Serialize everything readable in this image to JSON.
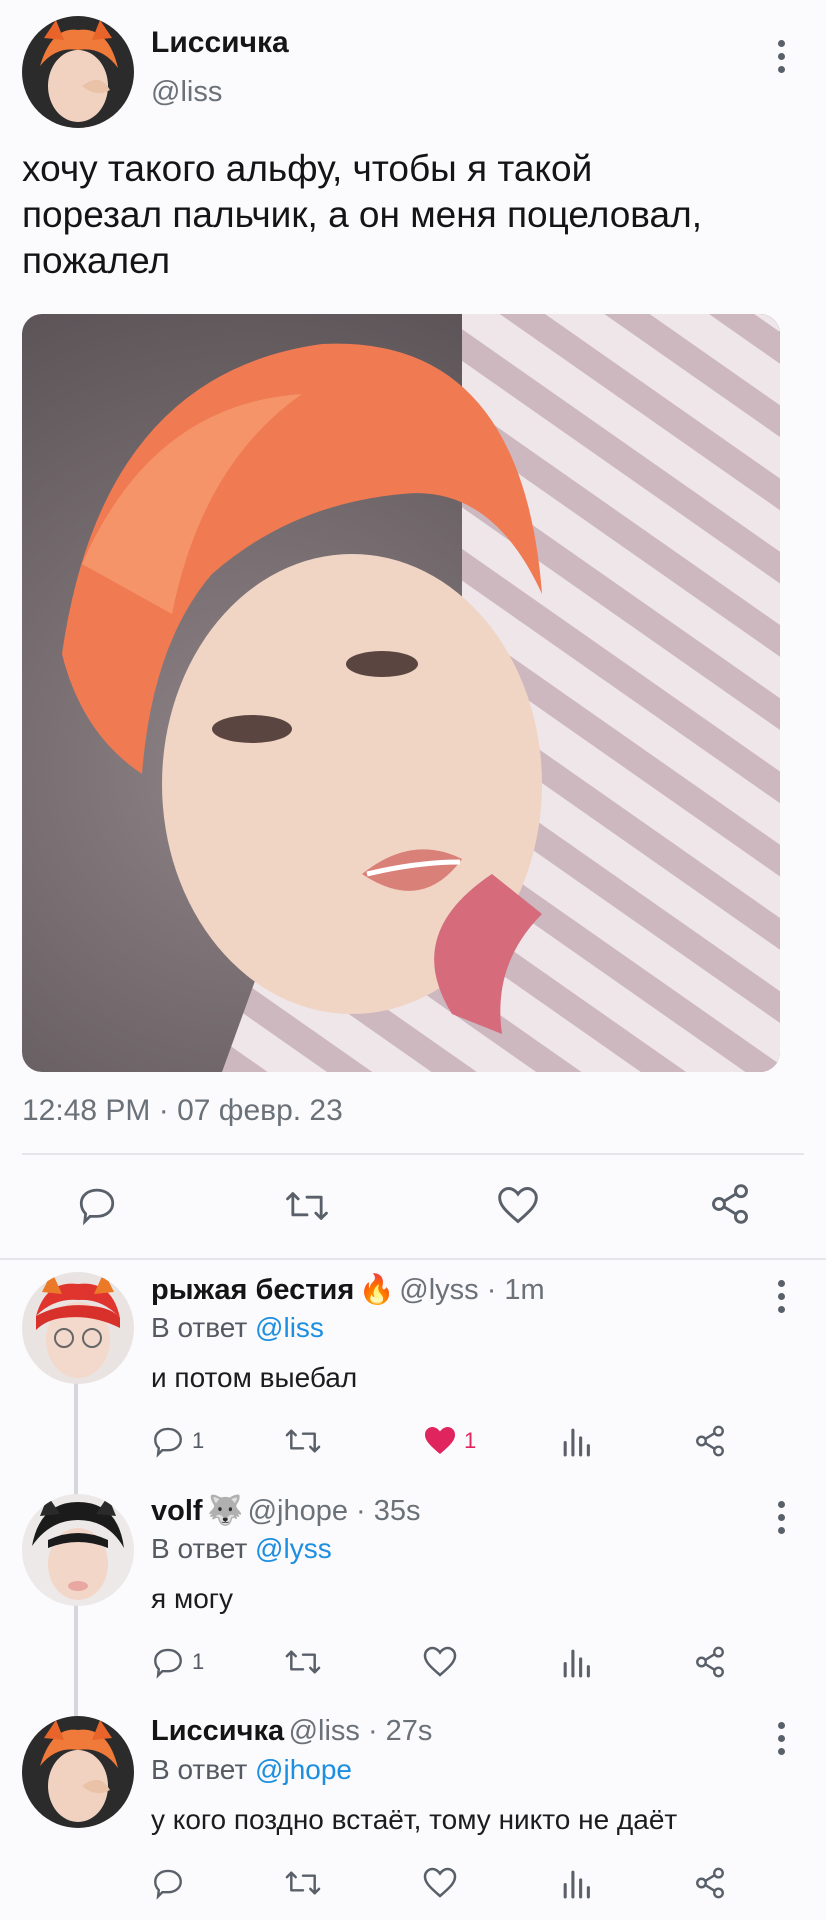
{
  "tweet": {
    "author_name": "Lиссичка",
    "author_handle": "@liss",
    "text_line1": "хочу такого  альфу,  чтобы я такой",
    "text_line2": "порезал пальчик, а он меня поцеловал,",
    "text_line3": "пожалел",
    "timestamp": "12:48 PM · 07 февр. 23"
  },
  "replies": [
    {
      "name": "рыжая бестия",
      "emoji": "🔥",
      "handle_time": "@lyss · 1m",
      "reply_prefix": "В ответ ",
      "reply_to": "@liss",
      "text": "и потом выебал",
      "reply_count": "1",
      "like_count": "1",
      "liked": true
    },
    {
      "name": "volf",
      "emoji": "🐺",
      "handle_time": "@jhope · 35s",
      "reply_prefix": "В ответ ",
      "reply_to": "@lyss",
      "text": "я могу",
      "reply_count": "1",
      "liked": false
    },
    {
      "name": "Lиссичка",
      "handle_time": "@liss · 27s",
      "reply_prefix": "В ответ ",
      "reply_to": "@jhope",
      "text": "у кого поздно встаёт,  тому никто не даёт",
      "liked": false
    }
  ],
  "colors": {
    "accent": "#1d8fe0",
    "like": "#e0245e",
    "icon": "#59606a"
  },
  "icons": [
    "reply-icon",
    "retweet-icon",
    "like-icon",
    "share-icon",
    "analytics-icon",
    "more-icon"
  ]
}
